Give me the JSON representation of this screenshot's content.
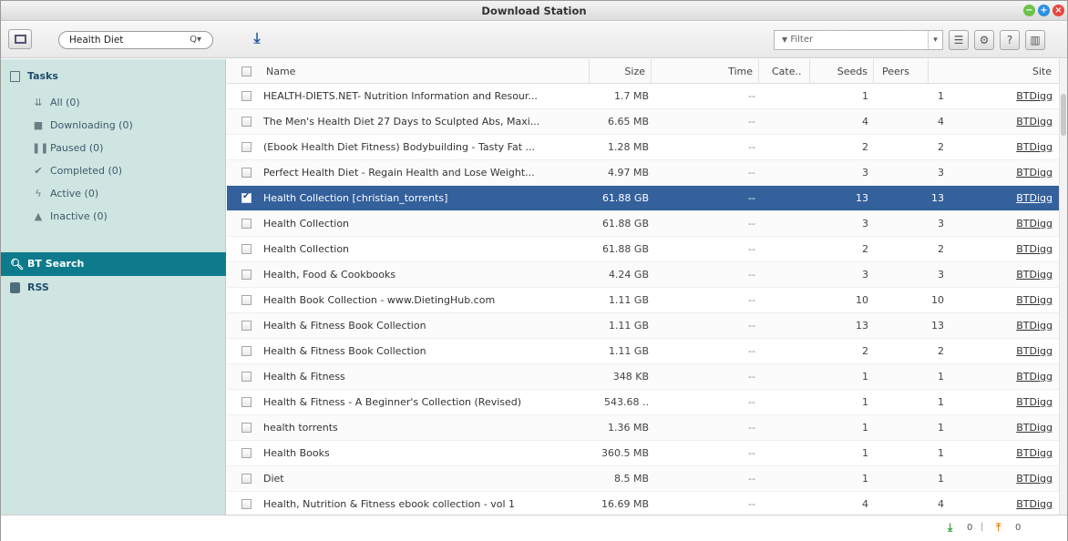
{
  "window": {
    "title": "Download Station"
  },
  "toolbar": {
    "search_value": "Health Diet",
    "search_icon": "Q▾",
    "filter_placeholder": "Filter",
    "filter_icon": "▼",
    "filter_arrow": "▾",
    "download_icon": "⤓"
  },
  "sidebar": {
    "tasks_label": "Tasks",
    "items": [
      {
        "label": "All (0)",
        "icon": "⇊"
      },
      {
        "label": "Downloading (0)",
        "icon": "■"
      },
      {
        "label": "Paused (0)",
        "icon": "❚❚"
      },
      {
        "label": "Completed (0)",
        "icon": "✔"
      },
      {
        "label": "Active (0)",
        "icon": "ϟ"
      },
      {
        "label": "Inactive (0)",
        "icon": "▲"
      }
    ],
    "bt_search_label": "BT Search",
    "rss_label": "RSS"
  },
  "table": {
    "columns": {
      "name": "Name",
      "size": "Size",
      "time": "Time",
      "category": "Cate..",
      "seeds": "Seeds",
      "peers": "Peers",
      "site": "Site"
    },
    "rows": [
      {
        "name": "HEALTH-DIETS.NET- Nutrition Information and Resour...",
        "size": "1.7 MB",
        "time": "--",
        "seeds": "1",
        "peers": "1",
        "site": "BTDigg",
        "selected": false
      },
      {
        "name": "The Men's Health Diet 27 Days to Sculpted Abs, Maxi...",
        "size": "6.65 MB",
        "time": "--",
        "seeds": "4",
        "peers": "4",
        "site": "BTDigg",
        "selected": false
      },
      {
        "name": "(Ebook Health Diet Fitness) Bodybuilding - Tasty Fat ...",
        "size": "1.28 MB",
        "time": "--",
        "seeds": "2",
        "peers": "2",
        "site": "BTDigg",
        "selected": false
      },
      {
        "name": "Perfect Health Diet - Regain Health and Lose Weight...",
        "size": "4.97 MB",
        "time": "--",
        "seeds": "3",
        "peers": "3",
        "site": "BTDigg",
        "selected": false
      },
      {
        "name": "Health Collection [christian_torrents]",
        "size": "61.88 GB",
        "time": "--",
        "seeds": "13",
        "peers": "13",
        "site": "BTDigg",
        "selected": true
      },
      {
        "name": "Health Collection",
        "size": "61.88 GB",
        "time": "--",
        "seeds": "3",
        "peers": "3",
        "site": "BTDigg",
        "selected": false
      },
      {
        "name": "Health Collection",
        "size": "61.88 GB",
        "time": "--",
        "seeds": "2",
        "peers": "2",
        "site": "BTDigg",
        "selected": false
      },
      {
        "name": "Health, Food & Cookbooks",
        "size": "4.24 GB",
        "time": "--",
        "seeds": "3",
        "peers": "3",
        "site": "BTDigg",
        "selected": false
      },
      {
        "name": "Health Book Collection - www.DietingHub.com",
        "size": "1.11 GB",
        "time": "--",
        "seeds": "10",
        "peers": "10",
        "site": "BTDigg",
        "selected": false
      },
      {
        "name": "Health & Fitness Book Collection",
        "size": "1.11 GB",
        "time": "--",
        "seeds": "13",
        "peers": "13",
        "site": "BTDigg",
        "selected": false
      },
      {
        "name": "Health & Fitness Book Collection",
        "size": "1.11 GB",
        "time": "--",
        "seeds": "2",
        "peers": "2",
        "site": "BTDigg",
        "selected": false
      },
      {
        "name": "Health & Fitness",
        "size": "348 KB",
        "time": "--",
        "seeds": "1",
        "peers": "1",
        "site": "BTDigg",
        "selected": false
      },
      {
        "name": "Health & Fitness - A Beginner's Collection (Revised)",
        "size": "543.68 ..",
        "time": "--",
        "seeds": "1",
        "peers": "1",
        "site": "BTDigg",
        "selected": false
      },
      {
        "name": "health torrents",
        "size": "1.36 MB",
        "time": "--",
        "seeds": "1",
        "peers": "1",
        "site": "BTDigg",
        "selected": false
      },
      {
        "name": "Health Books",
        "size": "360.5 MB",
        "time": "--",
        "seeds": "1",
        "peers": "1",
        "site": "BTDigg",
        "selected": false
      },
      {
        "name": "Diet",
        "size": "8.5 MB",
        "time": "--",
        "seeds": "1",
        "peers": "1",
        "site": "BTDigg",
        "selected": false
      },
      {
        "name": "Health, Nutrition & Fitness ebook collection - vol 1",
        "size": "16.69 MB",
        "time": "--",
        "seeds": "4",
        "peers": "4",
        "site": "BTDigg",
        "selected": false
      }
    ]
  },
  "status": {
    "download_icon": "⤓",
    "download_count": "0",
    "separator": "|",
    "upload_icon": "⤒",
    "upload_count": "0"
  },
  "colors": {
    "sidebar_bg": "#cfe5e2",
    "active_section": "#0d7b8c",
    "selected_row": "#34609c"
  }
}
